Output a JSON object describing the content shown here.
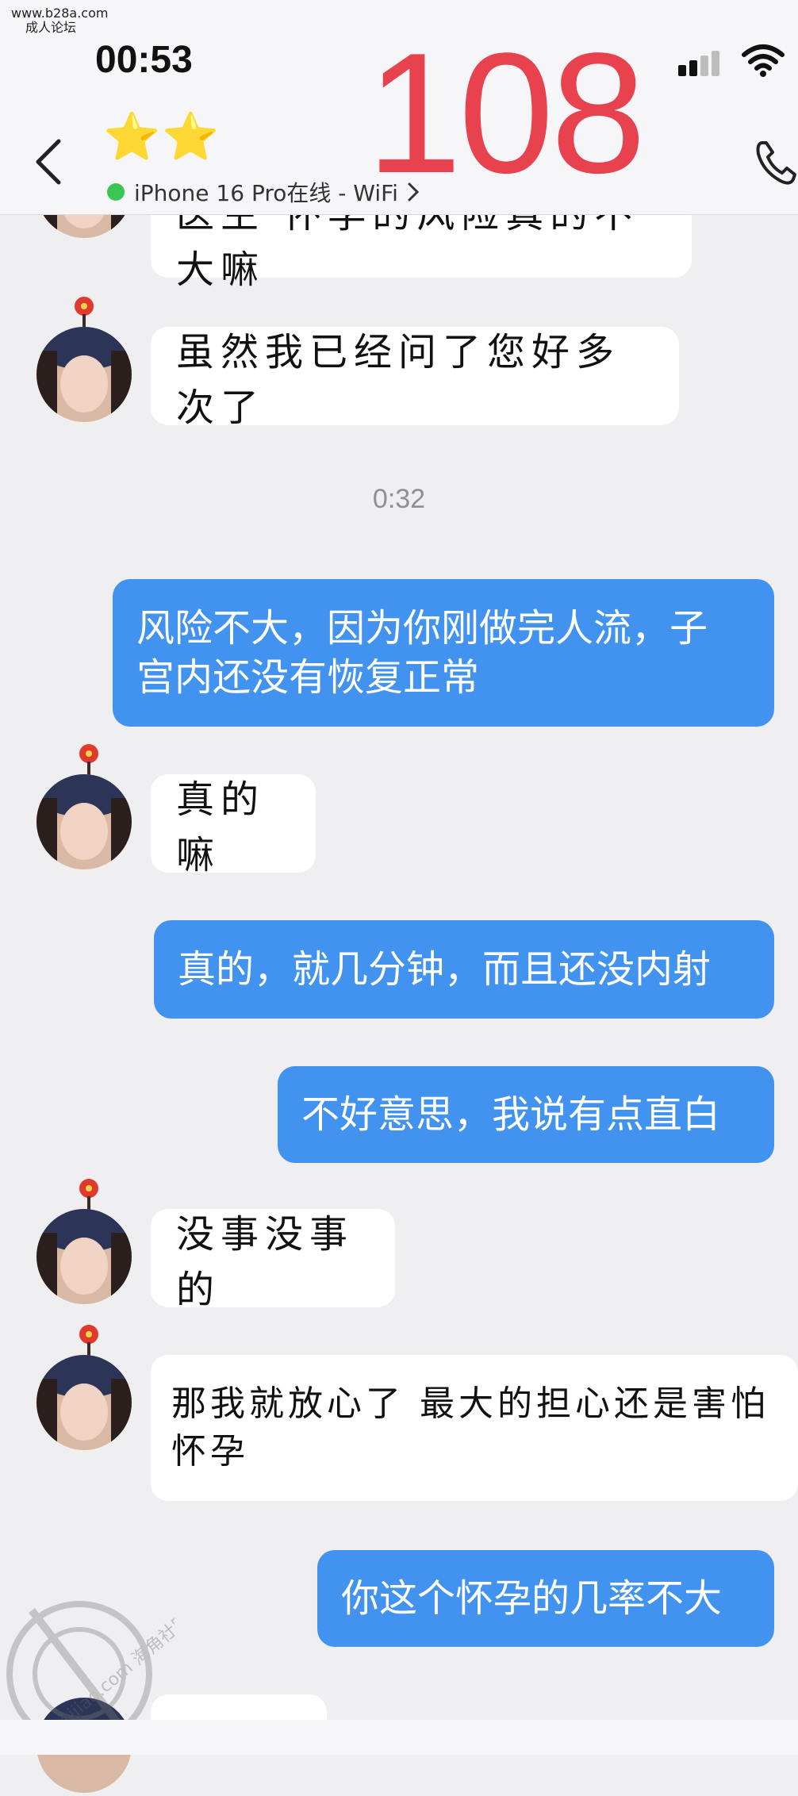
{
  "watermark": {
    "line1": "www.b28a.com",
    "line2": "成人论坛"
  },
  "status_bar": {
    "time": "00:53",
    "signal_icon": "cellular-signal-icon",
    "wifi_icon": "wifi-icon"
  },
  "overlay_number": "108",
  "header": {
    "back_icon": "chevron-left-icon",
    "stars": "⭐⭐",
    "device_status": "iPhone 16 Pro在线 - WiFi",
    "call_icon": "phone-icon"
  },
  "timestamp": "0:32",
  "messages": [
    {
      "side": "in",
      "text": "医生 怀孕的风险真的不大嘛"
    },
    {
      "side": "in",
      "text": "虽然我已经问了您好多次了"
    },
    {
      "side": "out",
      "line1": "风险不大，因为你刚做完人流，子",
      "line2": "宫内还没有恢复正常"
    },
    {
      "side": "in",
      "text": "真的嘛"
    },
    {
      "side": "out",
      "text": "真的，就几分钟，而且还没内射"
    },
    {
      "side": "out",
      "text": "不好意思，我说有点直白"
    },
    {
      "side": "in",
      "text": "没事没事的"
    },
    {
      "side": "in",
      "line1": "那我就放心了 最大的担心还是害怕",
      "line2": "怀孕"
    },
    {
      "side": "out",
      "text": "你这个怀孕的几率不大"
    }
  ],
  "corner_watermark": {
    "text": "haijiao.com 海角社区"
  }
}
